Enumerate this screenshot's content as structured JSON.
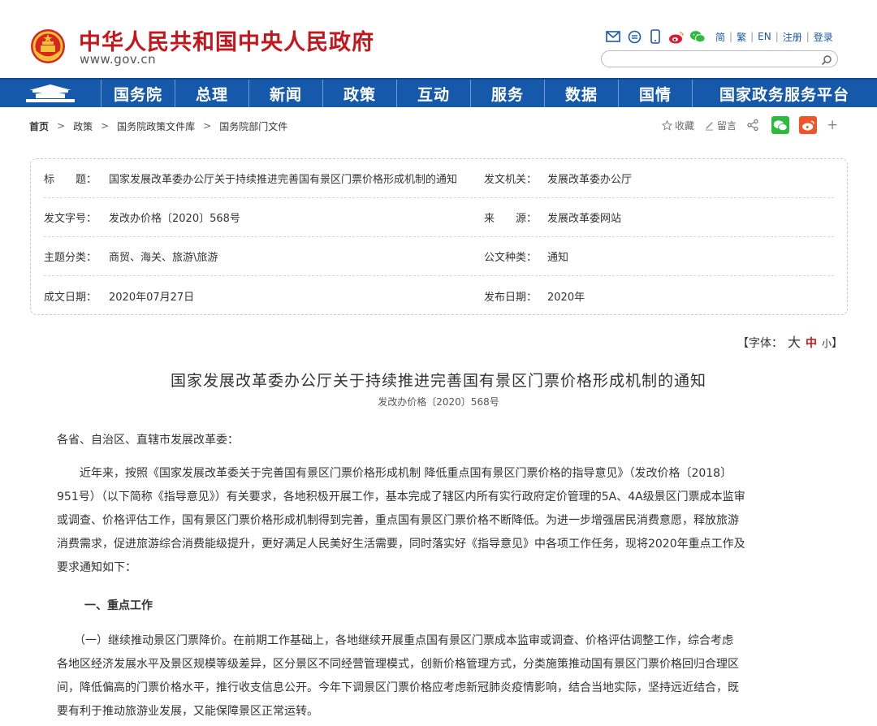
{
  "header": {
    "site_name": "中华人民共和国中央人民政府",
    "site_url": "www.gov.cn",
    "lang_links": [
      "简",
      "繁",
      "EN",
      "注册",
      "登录"
    ],
    "search_placeholder": ""
  },
  "nav": {
    "items": [
      "国务院",
      "总理",
      "新闻",
      "政策",
      "互动",
      "服务",
      "数据",
      "国情",
      "国家政务服务平台"
    ]
  },
  "breadcrumb": {
    "items": [
      "首页",
      "政策",
      "国务院政策文件库",
      "国务院部门文件"
    ]
  },
  "actions": {
    "favorite": "收藏",
    "comment": "留言"
  },
  "meta": {
    "rows": [
      {
        "label1": "标　　题：",
        "value1": "国家发展改革委办公厅关于持续推进完善国有景区门票价格形成机制的通知",
        "label2": "发文机关：",
        "value2": "发展改革委办公厅"
      },
      {
        "label1": "发文字号：",
        "value1": "发改办价格〔2020〕568号",
        "label2": "来　　源：",
        "value2": "发展改革委网站"
      },
      {
        "label1": "主题分类：",
        "value1": "商贸、海关、旅游\\旅游",
        "label2": "公文种类：",
        "value2": "通知"
      },
      {
        "label1": "成文日期：",
        "value1": "2020年07月27日",
        "label2": "发布日期：",
        "value2": "2020年"
      }
    ]
  },
  "fontsize": {
    "prefix": "【字体：",
    "large": "大",
    "medium": "中",
    "small": "小",
    "suffix": "】"
  },
  "article": {
    "title": "国家发展改革委办公厅关于持续推进完善国有景区门票价格形成机制的通知",
    "doc_number": "发改办价格〔2020〕568号",
    "greeting": "各省、自治区、直辖市发展改革委：",
    "paragraph1_lines": [
      "　　近年来，按照《国家发展改革委关于完善国有景区门票价格形成机制 降低重点国有景区门票价格的指导意见》（发改价格〔2018〕",
      "951号）（以下简称《指导意见》）有关要求，各地积极开展工作，基本完成了辖区内所有实行政府定价管理的5A、4A级景区门票成本监审",
      "或调查、价格评估工作，国有景区门票价格形成机制得到完善，重点国有景区门票价格不断降低。为进一步增强居民消费意愿，释放旅游",
      "消费需求，促进旅游综合消费能级提升，更好满足人民美好生活需要，同时落实好《指导意见》中各项工作任务，现将2020年重点工作及",
      "要求通知如下："
    ],
    "heading1": "一、重点工作",
    "paragraph2_lines": [
      "　　（一）继续推动景区门票降价。在前期工作基础上，各地继续开展重点国有景区门票成本监审或调查、价格评估调整工作，综合考虑",
      "各地区经济发展水平及景区规模等级差异，区分景区不同经营管理模式，创新价格管理方式，分类施策推动国有景区门票价格回归合理区",
      "间，降低偏高的门票价格水平，推行收支信息公开。今年下调景区门票价格应考虑新冠肺炎疫情影响，结合当地实际，坚持远近结合，既",
      "要有利于推动旅游业发展，又能保障景区正常运转。"
    ]
  },
  "colors": {
    "brand_red": "#c4161c",
    "nav_blue": "#1659aa",
    "link_blue": "#1b58a8",
    "wechat_green": "#2dbb3d",
    "weibo_orange": "#f0542a"
  }
}
